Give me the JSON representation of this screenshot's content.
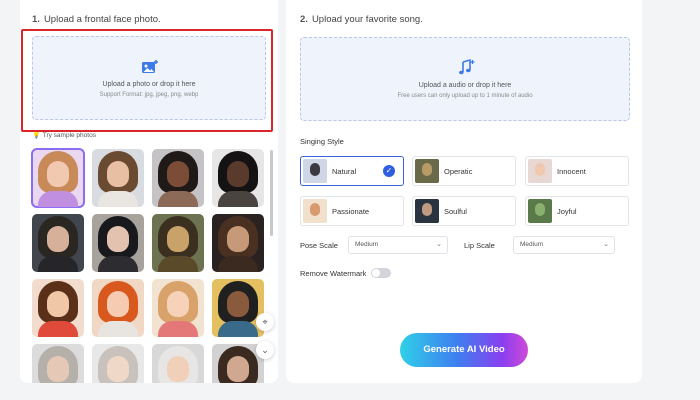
{
  "left": {
    "step_num": "1.",
    "step_title": "Upload a frontal face photo.",
    "upload_main": "Upload a photo or drop it here",
    "upload_sub": "Support Format: jpg, jpeg, png, webp",
    "try_sample": "Try sample photos",
    "samples": [
      {
        "hair": "#c98a5a",
        "face": "#f1c9b0",
        "body": "#c08fe0",
        "bg": "#ead7f0"
      },
      {
        "hair": "#6b4a32",
        "face": "#e9bfa3",
        "body": "#e9e6e2",
        "bg": "#d8dbe0"
      },
      {
        "hair": "#1f1a18",
        "face": "#7b4d36",
        "body": "#8d6a57",
        "bg": "#c5c3c5"
      },
      {
        "hair": "#141212",
        "face": "#5a3a2c",
        "body": "#4a4440",
        "bg": "#e6e6e6"
      },
      {
        "hair": "#2a2622",
        "face": "#d7b09a",
        "body": "#26262a",
        "bg": "#40454e"
      },
      {
        "hair": "#18191c",
        "face": "#e4c2b0",
        "body": "#2d2c30",
        "bg": "#a8a29c"
      },
      {
        "hair": "#3b2f20",
        "face": "#c9a26a",
        "body": "#5b4a2a",
        "bg": "#6d7250"
      },
      {
        "hair": "#4a3020",
        "face": "#c69a78",
        "body": "#3a2a20",
        "bg": "#2a2220"
      },
      {
        "hair": "#5a3018",
        "face": "#f0c8a8",
        "body": "#e04a3a",
        "bg": "#f2dccd"
      },
      {
        "hair": "#d8581e",
        "face": "#f5ccb2",
        "body": "#e8e4e0",
        "bg": "#f0d8c4"
      },
      {
        "hair": "#d8a26a",
        "face": "#f5d2b8",
        "body": "#e47878",
        "bg": "#f2e2d0"
      },
      {
        "hair": "#202020",
        "face": "#8a5a3c",
        "body": "#3a6a8a",
        "bg": "#e4c060"
      },
      {
        "hair": "#b5b0aa",
        "face": "#e6c8b6",
        "body": "#888888",
        "bg": "#dcdcdc"
      },
      {
        "hair": "#c9c2bc",
        "face": "#f0d8c8",
        "body": "#a0a0a0",
        "bg": "#e8e8e8"
      },
      {
        "hair": "#e8e6e4",
        "face": "#f0d0b8",
        "body": "#b8b8b8",
        "bg": "#d8d8d8"
      },
      {
        "hair": "#3a2a20",
        "face": "#d0a890",
        "body": "#6a5a50",
        "bg": "#d2d2d2"
      }
    ]
  },
  "right": {
    "step_num": "2.",
    "step_title": "Upload your favorite song.",
    "upload_main": "Upload a audio or drop it here",
    "upload_sub": "Free users can only upload up to 1 minute of audio",
    "singing_style_label": "Singing Style",
    "styles": [
      {
        "label": "Natural",
        "thumb_bg": "#cfd6e6",
        "thumb_face": "#3a3a40"
      },
      {
        "label": "Operatic",
        "thumb_bg": "#6a6a48",
        "thumb_face": "#b89a66"
      },
      {
        "label": "Innocent",
        "thumb_bg": "#e8d8d4",
        "thumb_face": "#f0c8b0"
      },
      {
        "label": "Passionate",
        "thumb_bg": "#f0e0cc",
        "thumb_face": "#d89a70"
      },
      {
        "label": "Soulful",
        "thumb_bg": "#2a3440",
        "thumb_face": "#c09a80"
      },
      {
        "label": "Joyful",
        "thumb_bg": "#5a7a4a",
        "thumb_face": "#8ab070"
      }
    ],
    "pose_scale_label": "Pose Scale",
    "pose_scale_value": "Medium",
    "lip_scale_label": "Lip Scale",
    "lip_scale_value": "Medium",
    "remove_watermark_label": "Remove Watermark",
    "generate_label": "Generate AI Video"
  },
  "colors": {
    "accent": "#2f5fe0",
    "highlight": "#d9262b",
    "upload_bg": "#eef3fc"
  }
}
